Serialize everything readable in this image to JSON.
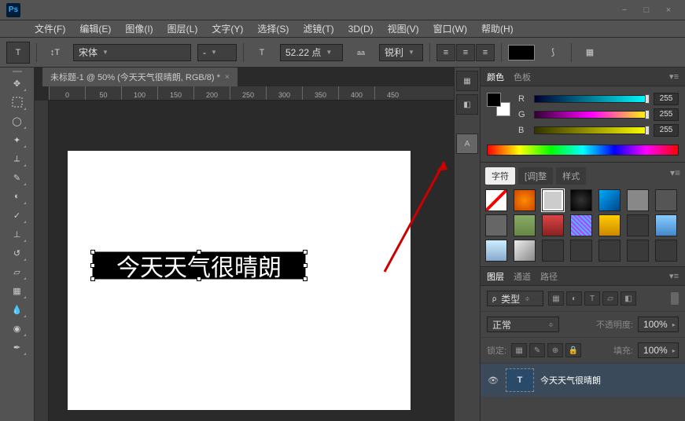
{
  "app": {
    "name": "Ps"
  },
  "window": {
    "min": "−",
    "max": "□",
    "close": "×"
  },
  "menus": [
    "文件(F)",
    "编辑(E)",
    "图像(I)",
    "图层(L)",
    "文字(Y)",
    "选择(S)",
    "滤镜(T)",
    "3D(D)",
    "视图(V)",
    "窗口(W)",
    "帮助(H)"
  ],
  "options": {
    "font_family": "宋体",
    "font_style": "-",
    "font_size": "52.22 点",
    "aa": "锐利"
  },
  "document": {
    "tab_title": "未标题-1 @ 50% (今天天气很晴朗, RGB/8) *",
    "text_content": "今天天气很晴朗"
  },
  "ruler": [
    "0",
    "50",
    "100",
    "150",
    "200",
    "250",
    "300",
    "350",
    "400",
    "450"
  ],
  "panels": {
    "color": {
      "tabs": [
        "颜色",
        "色板"
      ],
      "channels": [
        {
          "label": "R",
          "value": "255",
          "grad": "linear-gradient(90deg,#003,#0ff)"
        },
        {
          "label": "G",
          "value": "255",
          "grad": "linear-gradient(90deg,#303,#f0f,#ff0)"
        },
        {
          "label": "B",
          "value": "255",
          "grad": "linear-gradient(90deg,#330,#ff0)"
        }
      ]
    },
    "swatches": {
      "tabs": [
        "字符",
        "[调]整",
        "样式"
      ],
      "active": 0,
      "items": [
        {
          "bg": "linear-gradient(135deg,#fff 45%,#f00 45%,#f00 55%,#fff 55%)"
        },
        {
          "bg": "radial-gradient(circle,#ff8c00,#cc4400)"
        },
        {
          "bg": "#ccc",
          "sel": true
        },
        {
          "bg": "radial-gradient(circle,#333,#000)"
        },
        {
          "bg": "linear-gradient(135deg,#0af,#048)"
        },
        {
          "bg": "#888"
        },
        {
          "bg": "#555"
        },
        {
          "bg": "#666"
        },
        {
          "bg": "linear-gradient(#8a6,#684)"
        },
        {
          "bg": "linear-gradient(#d44,#822)"
        },
        {
          "bg": "repeating-linear-gradient(45deg,#f0f,#0ff 4px)"
        },
        {
          "bg": "linear-gradient(#fc0,#c80)"
        },
        {
          "bg": "#3a3a3a"
        },
        {
          "bg": "linear-gradient(#8cf,#48c)"
        },
        {
          "bg": "linear-gradient(#cef,#8ac)"
        },
        {
          "bg": "linear-gradient(135deg,#eee,#888)"
        },
        {
          "bg": "#3a3a3a"
        },
        {
          "bg": "#3a3a3a"
        },
        {
          "bg": "#3a3a3a"
        },
        {
          "bg": "#3a3a3a"
        },
        {
          "bg": "#3a3a3a"
        }
      ]
    },
    "layers": {
      "tabs": [
        "图层",
        "通道",
        "路径"
      ],
      "kind_label": "类型",
      "blend": "正常",
      "opacity_label": "不透明度:",
      "opacity_value": "100%",
      "lock_label": "锁定:",
      "fill_label": "填充:",
      "fill_value": "100%",
      "layer_name": "今天天气很晴朗",
      "layer_thumb": "T"
    }
  }
}
